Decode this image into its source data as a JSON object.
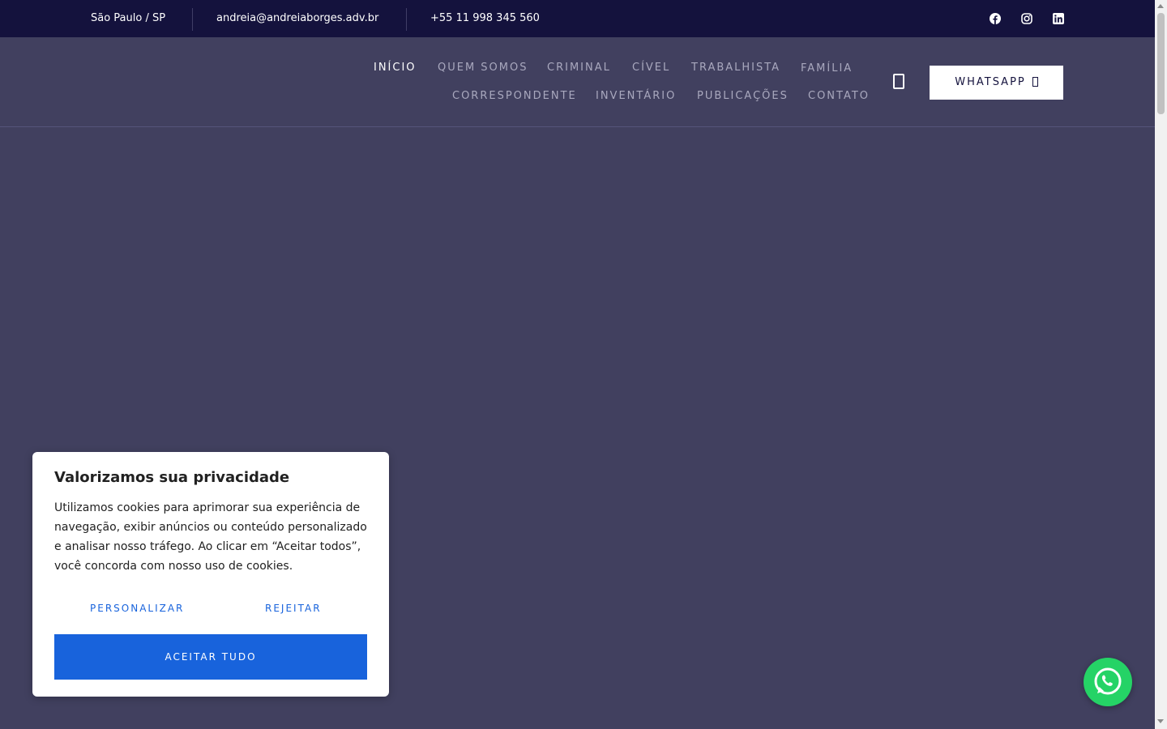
{
  "topbar": {
    "location": "São Paulo / SP",
    "email": "andreia@andreiaborges.adv.br",
    "phone": "+55 11 998 345 560",
    "social_icons": [
      "facebook-icon",
      "instagram-icon",
      "linkedin-icon"
    ]
  },
  "nav": {
    "items": [
      {
        "label": "INÍCIO",
        "active": true
      },
      {
        "label": "QUEM SOMOS"
      },
      {
        "label": "CRIMINAL"
      },
      {
        "label": "CÍVEL"
      },
      {
        "label": "TRABALHISTA"
      },
      {
        "label": "FAMÍLIA",
        "has_dropdown": true
      },
      {
        "label": "CORRESPONDENTE"
      },
      {
        "label": "INVENTÁRIO"
      },
      {
        "label": "PUBLICAÇÕES"
      },
      {
        "label": "CONTATO"
      }
    ],
    "dropdown_caret": "",
    "whatsapp_label": "WHATSAPP"
  },
  "cookie": {
    "title": "Valorizamos sua privacidade",
    "text": "Utilizamos cookies para aprimorar sua experiência de navegação, exibir anúncios ou conteúdo personalizado e analisar nosso tráfego. Ao clicar em “Aceitar todos”, você concorda com nosso uso de cookies.",
    "customize_label": "PERSONALIZAR",
    "reject_label": "REJEITAR",
    "accept_label": "ACEITAR TUDO"
  },
  "colors": {
    "topbar_bg": "#14123d",
    "page_bg": "#41405f",
    "accent_blue": "#1863dc",
    "whatsapp_green": "#25d366",
    "caret": "#c9824a"
  }
}
